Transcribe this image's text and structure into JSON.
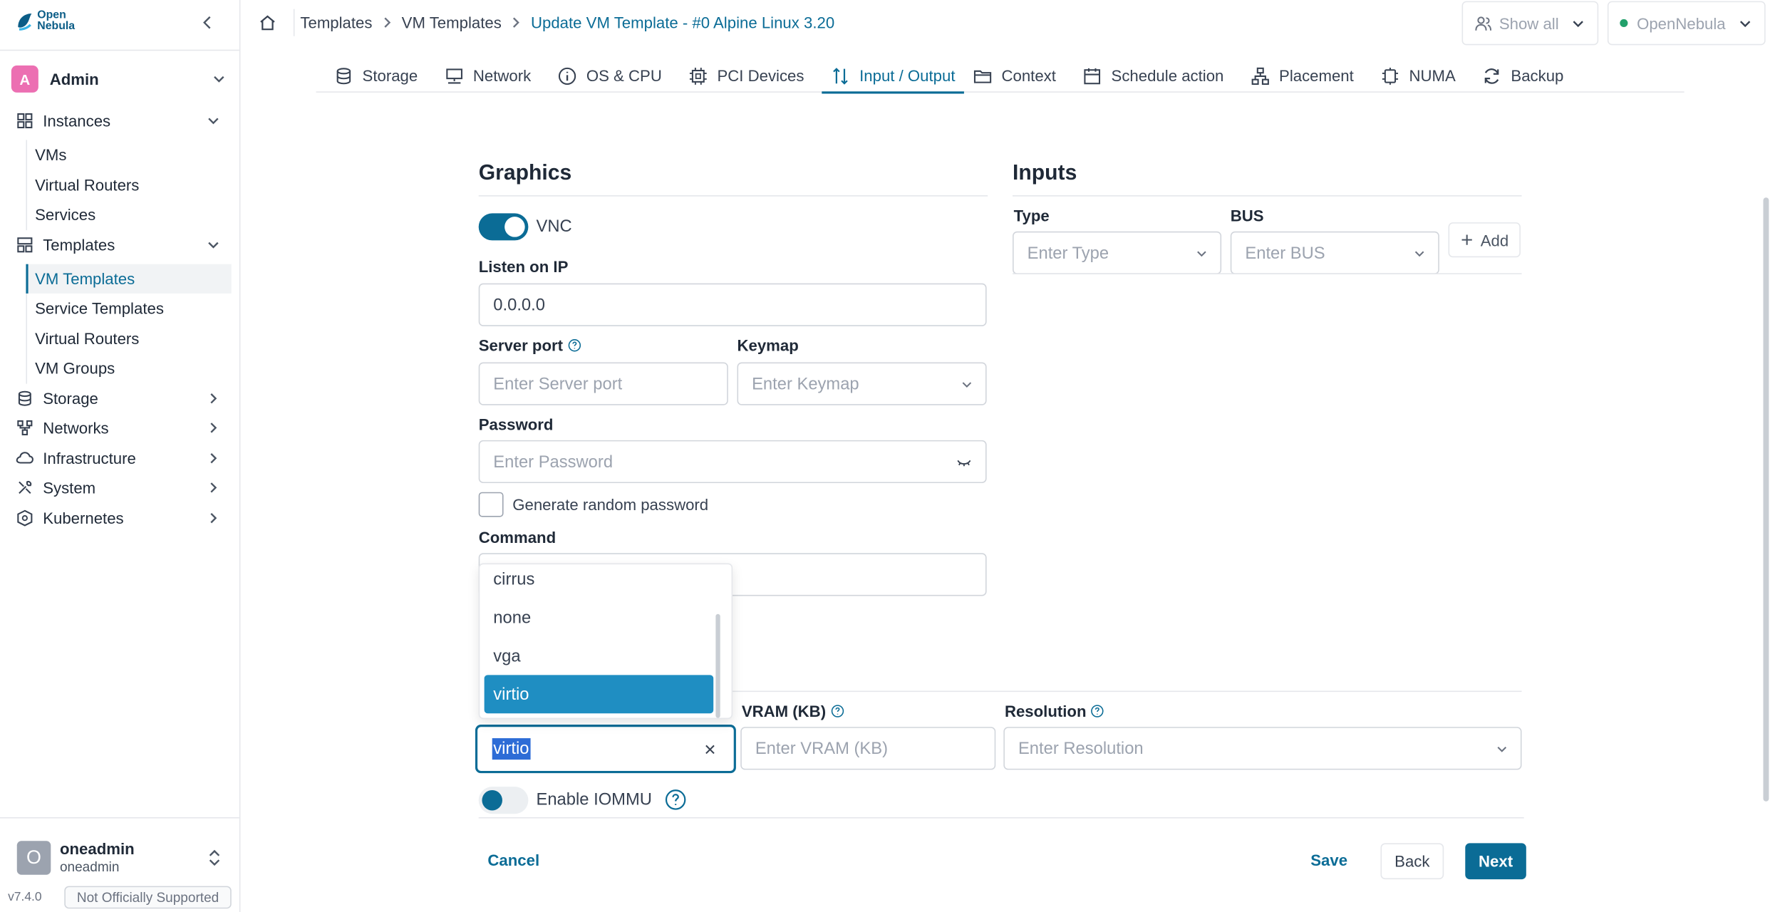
{
  "app": {
    "logo_line1": "Open",
    "logo_line2": "Nebula"
  },
  "sidebar": {
    "user": {
      "initial": "A",
      "name": "Admin"
    },
    "sections": [
      {
        "label": "Instances",
        "icon": "grid-icon",
        "expanded": true,
        "items": [
          "VMs",
          "Virtual Routers",
          "Services"
        ]
      },
      {
        "label": "Templates",
        "icon": "template-icon",
        "expanded": true,
        "items": [
          "VM Templates",
          "Service Templates",
          "Virtual Routers",
          "VM Groups"
        ]
      },
      {
        "label": "Storage",
        "icon": "database-icon",
        "expanded": false
      },
      {
        "label": "Networks",
        "icon": "network-icon",
        "expanded": false
      },
      {
        "label": "Infrastructure",
        "icon": "cloud-icon",
        "expanded": false
      },
      {
        "label": "System",
        "icon": "tools-icon",
        "expanded": false
      },
      {
        "label": "Kubernetes",
        "icon": "kubernetes-icon",
        "expanded": false
      }
    ],
    "active_item": "VM Templates",
    "account": {
      "initial": "O",
      "name": "oneadmin",
      "group": "oneadmin"
    },
    "version": "v7.4.0",
    "support_badge": "Not Officially Supported"
  },
  "header": {
    "breadcrumb": [
      "Templates",
      "VM Templates",
      "Update VM Template - #0 Alpine Linux 3.20"
    ],
    "filter_label": "Show all",
    "zone_label": "OpenNebula",
    "zone_status_color": "#22a06b"
  },
  "tabs": [
    {
      "label": "Storage",
      "icon": "database-icon"
    },
    {
      "label": "Network",
      "icon": "monitor-network-icon"
    },
    {
      "label": "OS & CPU",
      "icon": "info-icon"
    },
    {
      "label": "PCI Devices",
      "icon": "chip-icon"
    },
    {
      "label": "Input / Output",
      "icon": "arrows-updown-icon",
      "active": true
    },
    {
      "label": "Context",
      "icon": "folder-icon"
    },
    {
      "label": "Schedule action",
      "icon": "calendar-icon"
    },
    {
      "label": "Placement",
      "icon": "hierarchy-icon"
    },
    {
      "label": "NUMA",
      "icon": "cpu-icon"
    },
    {
      "label": "Backup",
      "icon": "refresh-icon"
    }
  ],
  "graphics": {
    "title": "Graphics",
    "vnc_label": "VNC",
    "vnc_enabled": true,
    "listen_label": "Listen on IP",
    "listen_value": "0.0.0.0",
    "port_label": "Server port",
    "port_placeholder": "Enter Server port",
    "keymap_label": "Keymap",
    "keymap_placeholder": "Enter Keymap",
    "password_label": "Password",
    "password_placeholder": "Enter Password",
    "random_password_label": "Generate random password",
    "random_password_checked": false,
    "command_label": "Command"
  },
  "inputs": {
    "title": "Inputs",
    "type_label": "Type",
    "type_placeholder": "Enter Type",
    "bus_label": "BUS",
    "bus_placeholder": "Enter BUS",
    "add_label": "Add"
  },
  "video": {
    "model_options": [
      "cirrus",
      "none",
      "vga",
      "virtio"
    ],
    "model_selected": "virtio",
    "model_value": "virtio",
    "vram_label": "VRAM (KB)",
    "vram_placeholder": "Enter VRAM (KB)",
    "resolution_label": "Resolution",
    "resolution_placeholder": "Enter Resolution",
    "iommu_label": "Enable IOMMU",
    "iommu_enabled": false
  },
  "footer": {
    "cancel_label": "Cancel",
    "save_label": "Save",
    "back_label": "Back",
    "next_label": "Next"
  },
  "colors": {
    "accent": "#0b6c96",
    "selected_option": "#1f8ec2",
    "avatar_admin": "#ec6fb2"
  }
}
